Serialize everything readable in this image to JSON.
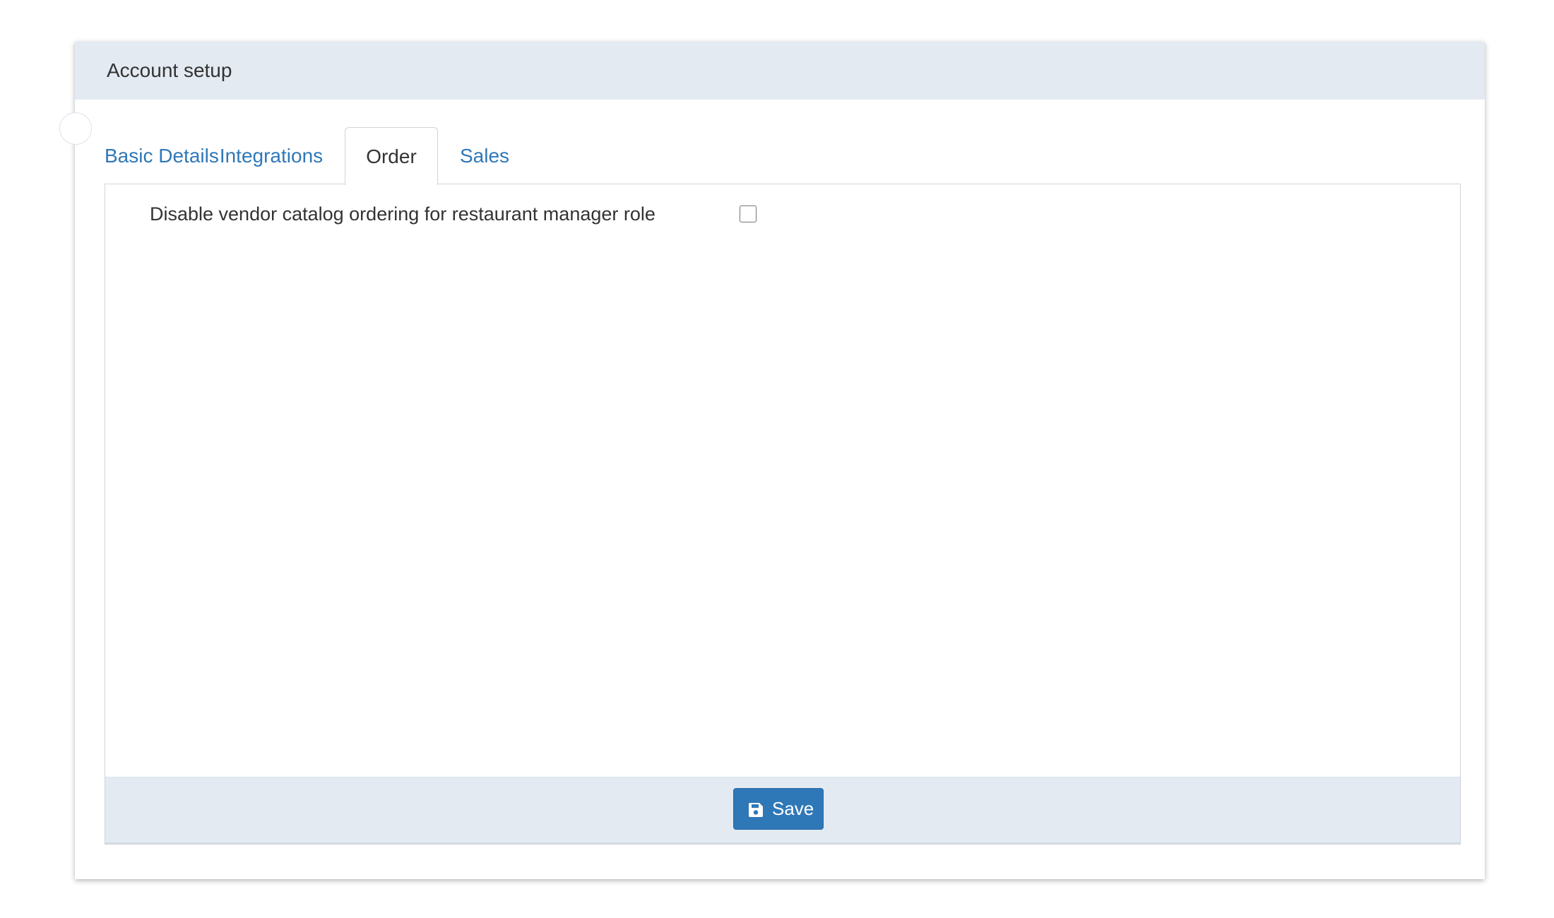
{
  "card": {
    "title": "Account setup"
  },
  "tabs": [
    {
      "label": "Basic Details",
      "active": false
    },
    {
      "label": "Integrations",
      "active": false
    },
    {
      "label": "Order",
      "active": true
    },
    {
      "label": "Sales",
      "active": false
    }
  ],
  "order_tab": {
    "options": [
      {
        "label": "Disable vendor catalog ordering for restaurant manager role",
        "checked": false
      }
    ]
  },
  "footer": {
    "save_label": "Save",
    "save_icon": "floppy-disk-icon"
  },
  "colors": {
    "header_bg": "#e4eaf2",
    "link": "#2f78b8",
    "primary_button": "#2f78b8",
    "text": "#333333"
  }
}
